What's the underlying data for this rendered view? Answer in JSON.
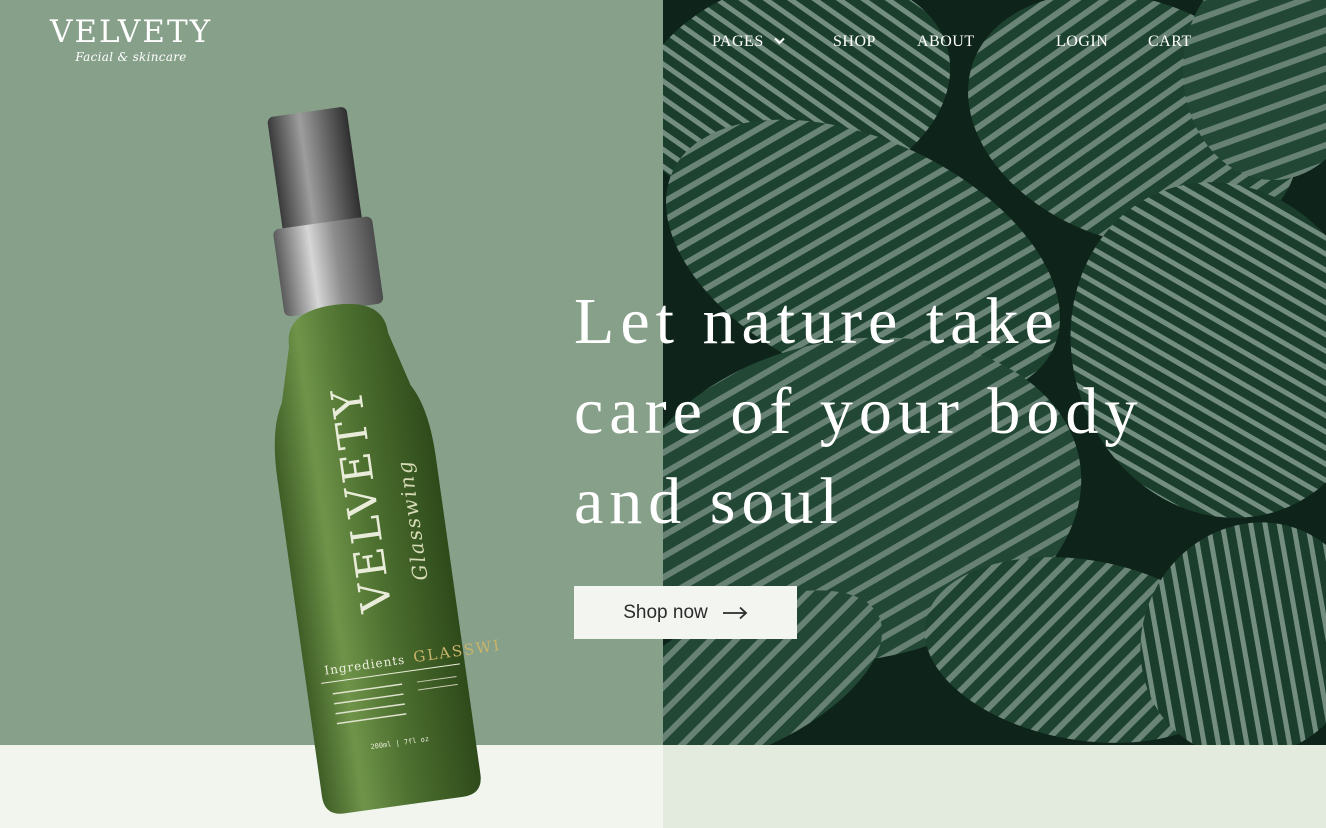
{
  "brand": {
    "name": "VELVETY",
    "tagline": "Facial & skincare"
  },
  "nav": {
    "pages": "PAGES",
    "shop": "SHOP",
    "about": "ABOUT",
    "login": "LOGIN",
    "cart": "CART"
  },
  "hero": {
    "headline_lines": [
      "Let nature take",
      "care of your body",
      "and soul"
    ],
    "cta_label": "Shop now",
    "cta_icon": "arrow-right-icon"
  },
  "product": {
    "brand": "VELVETY",
    "script_name": "Glasswing",
    "ingredients_label": "Ingredients",
    "side_label": "GLASSWI",
    "volume": "200ml | 7fl oz"
  },
  "colors": {
    "sage": "#87a08a",
    "leaf_dark": "#0f251b",
    "bottle_green": "#4f7431",
    "cap_silver": "#9a9a9a",
    "button_bg": "#f3f5f0",
    "footer_left": "#f1f5ee",
    "footer_right": "#e3ebdf"
  }
}
